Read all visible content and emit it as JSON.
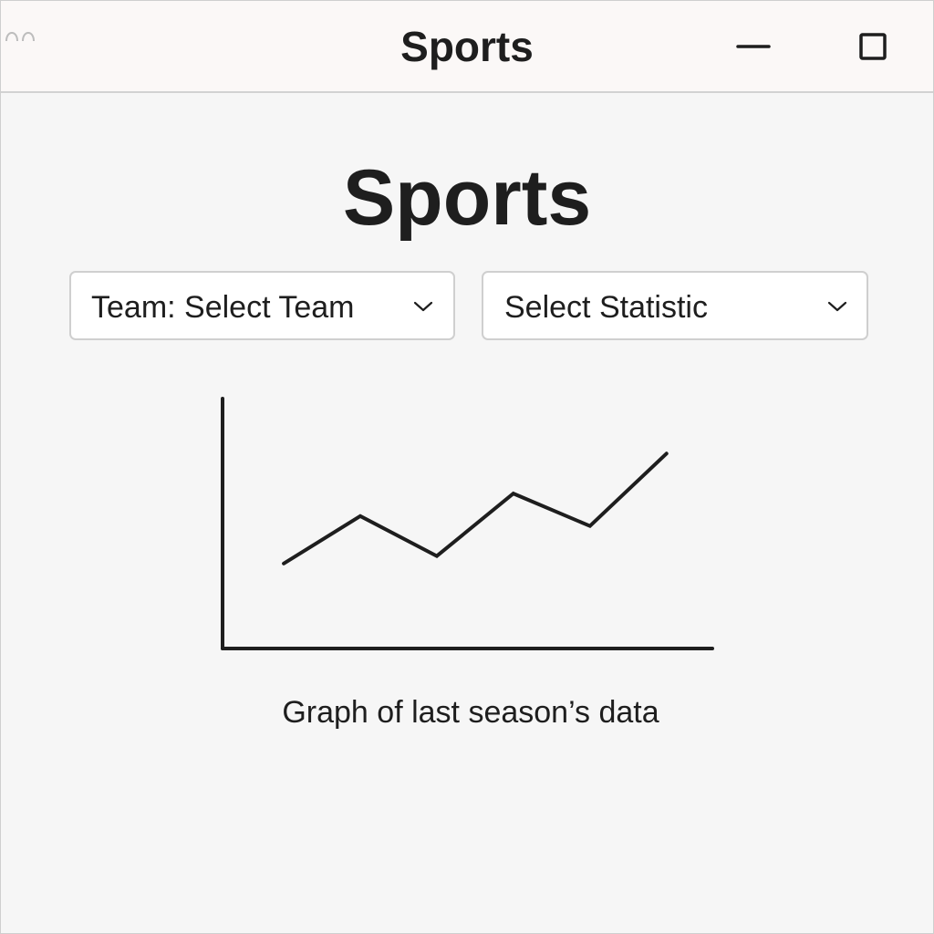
{
  "window": {
    "title": "Sports"
  },
  "page": {
    "heading": "Sports"
  },
  "filters": {
    "team": {
      "selected": "Team: Select Team"
    },
    "statistic": {
      "selected": "Select Statistic"
    }
  },
  "chart": {
    "caption": "Graph of last season’s data"
  },
  "chart_data": {
    "type": "line",
    "title": "",
    "xlabel": "",
    "ylabel": "",
    "x": [
      1,
      2,
      3,
      4,
      5,
      6
    ],
    "series": [
      {
        "values": [
          3.4,
          5.3,
          3.7,
          6.2,
          4.9,
          7.8
        ]
      }
    ],
    "xlim": [
      0.2,
      6.6
    ],
    "ylim": [
      0,
      10
    ],
    "grid": false,
    "ticks_shown": false
  },
  "icons": {
    "window_controls": [
      "minimize-icon",
      "maximize-icon"
    ],
    "dropdown": "chevron-down-icon"
  },
  "colors": {
    "line": "#1e1e1e",
    "background": "#f6f6f6",
    "titlebar": "#fbf8f7"
  }
}
